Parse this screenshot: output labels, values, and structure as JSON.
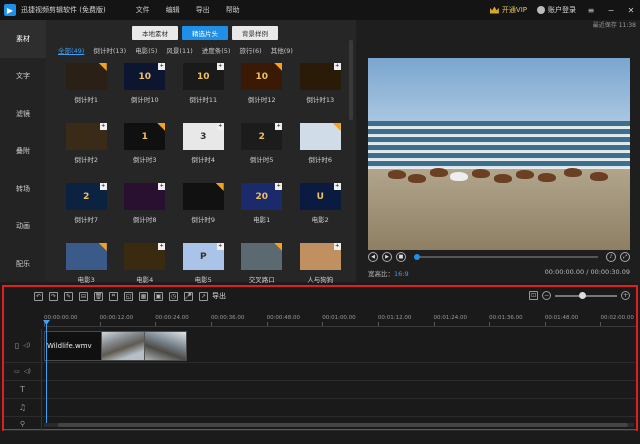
{
  "app": {
    "title": "迅捷视频剪辑软件 (免费版)"
  },
  "menu": [
    "文件",
    "编辑",
    "导出",
    "帮助"
  ],
  "titlebar": {
    "vip_label": "开通VIP",
    "account_label": "账户登录"
  },
  "leftnav": {
    "items": [
      "素材",
      "文字",
      "滤镜",
      "叠附",
      "转场",
      "动画",
      "配乐"
    ],
    "active": "素材"
  },
  "media": {
    "tabs": [
      {
        "label": "本地素材",
        "active": false
      },
      {
        "label": "精选片头",
        "active": true
      },
      {
        "label": "背景样例",
        "active": false
      }
    ],
    "categories": [
      "全部(49)",
      "倒计时(13)",
      "电影(5)",
      "风景(11)",
      "进度条(5)",
      "旅行(6)",
      "其他(9)"
    ],
    "items": [
      {
        "label": "倒计时1",
        "glyph": "",
        "bg": "#2a2015"
      },
      {
        "label": "倒计时10",
        "glyph": "10",
        "bg": "#0d1630"
      },
      {
        "label": "倒计时11",
        "glyph": "10",
        "bg": "#1a1a1a"
      },
      {
        "label": "倒计时12",
        "glyph": "10",
        "bg": "#3a1a05"
      },
      {
        "label": "倒计时13",
        "glyph": "",
        "bg": "#2a1a08"
      },
      {
        "label": "倒计时2",
        "glyph": "",
        "bg": "#3a2a18"
      },
      {
        "label": "倒计时3",
        "glyph": "1",
        "bg": "#101010"
      },
      {
        "label": "倒计时4",
        "glyph": "3",
        "bg": "#e8e8e8"
      },
      {
        "label": "倒计时5",
        "glyph": "2",
        "bg": "#1c1c1c"
      },
      {
        "label": "倒计时6",
        "glyph": "",
        "bg": "#d0dde8"
      },
      {
        "label": "倒计时7",
        "glyph": "2",
        "bg": "#0b2340"
      },
      {
        "label": "倒计时8",
        "glyph": "",
        "bg": "#2a1030"
      },
      {
        "label": "倒计时9",
        "glyph": "",
        "bg": "#111111"
      },
      {
        "label": "电影1",
        "glyph": "20",
        "bg": "#1a2a6a"
      },
      {
        "label": "电影2",
        "glyph": "U",
        "bg": "#0a1a40"
      },
      {
        "label": "电影3",
        "glyph": "",
        "bg": "#3a5a8a"
      },
      {
        "label": "电影4",
        "glyph": "",
        "bg": "#3a2a10"
      },
      {
        "label": "电影5",
        "glyph": "P",
        "bg": "#a9c4e8"
      },
      {
        "label": "交叉路口",
        "glyph": "",
        "bg": "#5a6a70"
      },
      {
        "label": "人与狗狗",
        "glyph": "",
        "bg": "#c09060"
      }
    ]
  },
  "preview": {
    "saved": "最近保存 11:38",
    "ratio_label": "宽高比：",
    "ratio_value": "16:9",
    "timecode": "00:00:00.00 / 00:00:30.09"
  },
  "timeline": {
    "export_label": "导出",
    "ruler": [
      "00:00:00.00",
      "00:00:12.00",
      "00:00:24.00",
      "00:00:36.00",
      "00:00:48.00",
      "00:01:00.00",
      "00:01:12.00",
      "00:01:24.00",
      "00:01:36.00",
      "00:01:48.00",
      "00:02:00.00"
    ],
    "clip_name": "Wildlife.wmv"
  },
  "colors": {
    "accent": "#1f8fe8",
    "highlight_border": "#e02020",
    "vip": "#e9c46a"
  }
}
